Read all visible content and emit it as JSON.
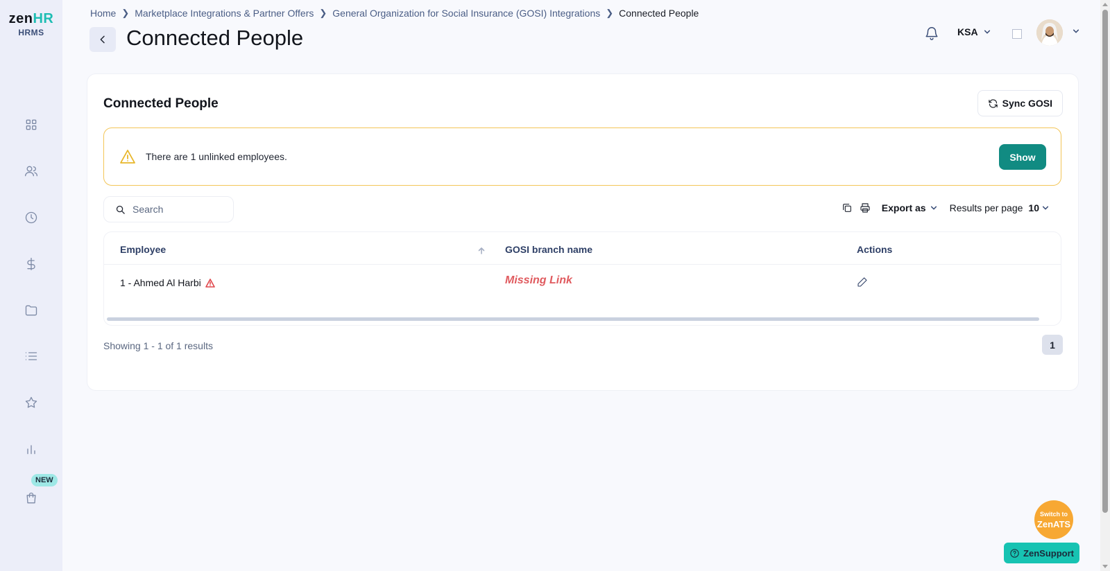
{
  "logo": {
    "main_a": "zen",
    "main_b": "HR",
    "sub": "HRMS"
  },
  "sidebar": {
    "items": [
      {
        "name": "dashboard",
        "icon": "grid-icon"
      },
      {
        "name": "people",
        "icon": "users-icon"
      },
      {
        "name": "time",
        "icon": "clock-icon"
      },
      {
        "name": "payroll",
        "icon": "dollar-icon"
      },
      {
        "name": "documents",
        "icon": "folder-icon"
      },
      {
        "name": "lists",
        "icon": "list-icon"
      },
      {
        "name": "performance",
        "icon": "star-icon"
      },
      {
        "name": "reports",
        "icon": "bar-chart-icon"
      },
      {
        "name": "marketplace",
        "icon": "shopping-bag-icon"
      }
    ],
    "new_badge": "NEW"
  },
  "breadcrumb": {
    "items": [
      "Home",
      "Marketplace Integrations & Partner Offers",
      "General Organization for Social Insurance (GOSI) Integrations"
    ],
    "current": "Connected People"
  },
  "header": {
    "title": "Connected People",
    "region": "KSA"
  },
  "card": {
    "title": "Connected People",
    "sync_label": "Sync GOSI",
    "alert": {
      "text": "There are 1 unlinked employees.",
      "button": "Show"
    },
    "search": {
      "placeholder": "Search",
      "value": ""
    },
    "toolbar": {
      "export_label": "Export as",
      "rpp_label": "Results per page",
      "rpp_value": "10"
    },
    "table": {
      "columns": [
        "Employee",
        "GOSI branch name",
        "Actions"
      ],
      "rows": [
        {
          "employee": "1 - Ahmed Al Harbi",
          "branch": "Missing Link"
        }
      ]
    },
    "showing": "Showing 1 - 1 of 1 results",
    "page": "1"
  },
  "floating": {
    "zenats_top": "Switch to",
    "zenats_main": "ZenATS",
    "support": "ZenSupport"
  },
  "colors": {
    "accent": "#118b82",
    "warning": "#f3c557",
    "danger": "#e05b5f",
    "brand_teal": "#1dbdb3"
  }
}
